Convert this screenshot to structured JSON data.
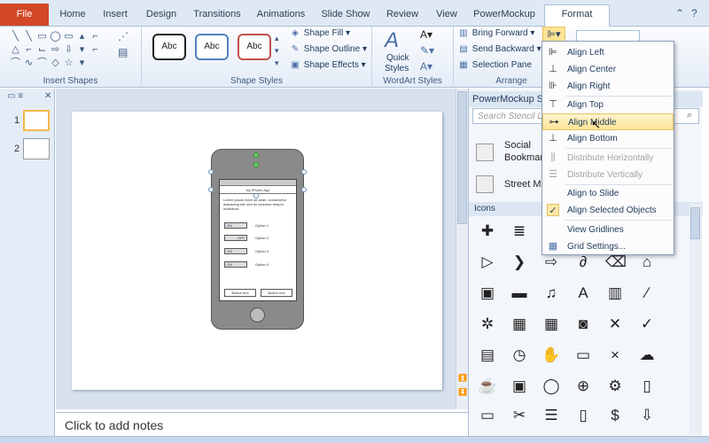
{
  "tabs": {
    "file": "File",
    "home": "Home",
    "insert": "Insert",
    "design": "Design",
    "transitions": "Transitions",
    "animations": "Animations",
    "slideshow": "Slide Show",
    "review": "Review",
    "view": "View",
    "powermockup": "PowerMockup",
    "format": "Format"
  },
  "ribbon": {
    "insert_shapes_label": "Insert Shapes",
    "shape_styles_label": "Shape Styles",
    "style_sample": "Abc",
    "shape_fill": "Shape Fill",
    "shape_outline": "Shape Outline",
    "shape_effects": "Shape Effects",
    "wordart_label": "WordArt Styles",
    "quick_styles": "Quick",
    "quick_styles2": "Styles",
    "bring_forward": "Bring Forward",
    "send_backward": "Send Backward",
    "selection_pane": "Selection Pane",
    "arrange_label": "Arrange"
  },
  "slides": {
    "n1": "1",
    "n2": "2"
  },
  "notes_placeholder": "Click to add notes",
  "phone": {
    "body_text": "Lorem ipsum dolor sit amet, consectetur adipiscing elit, sed do eiusmod tempor incididunt.",
    "toggle_on": "ON",
    "toggle_off": "OFF",
    "opt1": "Option 1",
    "opt2": "Option 2",
    "opt3": "Option 3",
    "opt4": "Option 4",
    "btn1": "Button text",
    "btn2": "Button text",
    "header_text": "My iPhone App"
  },
  "pm": {
    "title": "PowerMockup Ste",
    "search_placeholder": "Search Stencil Libr",
    "stencil1a": "Social",
    "stencil1b": "Bookmar",
    "stencil2": "Street Ma",
    "icons_label": "Icons"
  },
  "dropdown": {
    "align_left": "Align Left",
    "align_center": "Align Center",
    "align_right": "Align Right",
    "align_top": "Align Top",
    "align_middle": "Align Middle",
    "align_bottom": "Align Bottom",
    "dist_h": "Distribute Horizontally",
    "dist_v": "Distribute Vertically",
    "align_slide": "Align to Slide",
    "align_selected": "Align Selected Objects",
    "view_gridlines": "View Gridlines",
    "grid_settings": "Grid Settings..."
  },
  "colors": {
    "file_tab": "#d24726",
    "highlight": "#ffe495"
  }
}
